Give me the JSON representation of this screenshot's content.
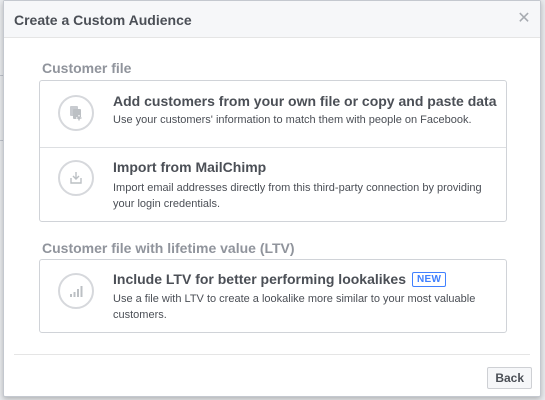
{
  "dialog": {
    "title": "Create a Custom Audience",
    "close_icon": "close-icon"
  },
  "sections": [
    {
      "heading": "Customer file",
      "options": [
        {
          "icon": "add-file-icon",
          "title": "Add customers from your own file or copy and paste data",
          "description": "Use your customers' information to match them with people on Facebook."
        },
        {
          "icon": "import-icon",
          "title": "Import from MailChimp",
          "description": "Import email addresses directly from this third-party connection by providing your login credentials."
        }
      ]
    },
    {
      "heading": "Customer file with lifetime value (LTV)",
      "options": [
        {
          "icon": "bar-chart-icon",
          "title": "Include LTV for better performing lookalikes",
          "badge": "NEW",
          "description": "Use a file with LTV to create a lookalike more similar to your most valuable customers."
        }
      ]
    }
  ],
  "footer": {
    "back_label": "Back"
  },
  "colors": {
    "header_bg": "#f6f7f9",
    "text": "#4b4f56",
    "muted_heading": "#90949c",
    "badge": "#4080ff"
  }
}
